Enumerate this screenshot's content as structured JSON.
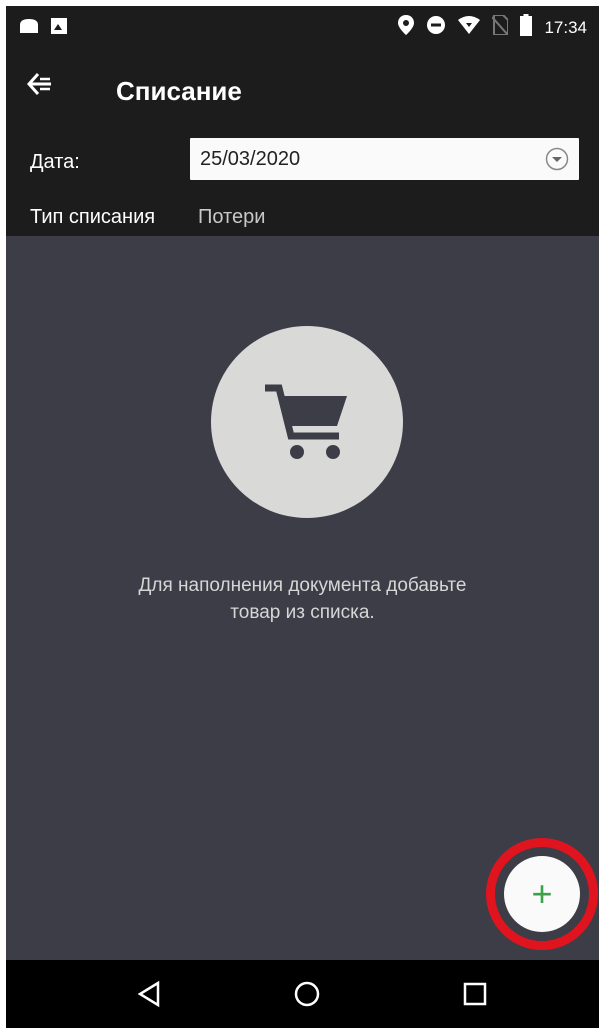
{
  "status_bar": {
    "time": "17:34",
    "icons_left": [
      "notification-icon",
      "photo-icon"
    ],
    "icons_right": [
      "location-icon",
      "do-not-disturb-icon",
      "wifi-icon",
      "no-sim-icon",
      "battery-icon"
    ]
  },
  "app_bar": {
    "title": "Списание",
    "back_icon": "back-icon"
  },
  "form": {
    "date_label": "Дата:",
    "date_value": "25/03/2020",
    "type_label": "Тип списания",
    "type_value": "Потери"
  },
  "empty_state": {
    "icon": "cart-icon",
    "message": "Для наполнения документа добавьте товар из списка."
  },
  "fab": {
    "label": "+",
    "highlight_color": "#e0141e"
  },
  "nav": {
    "buttons": [
      "back-triangle-icon",
      "home-circle-icon",
      "recents-square-icon"
    ]
  },
  "colors": {
    "background": "#3c3d47",
    "bar": "#1c1c1c",
    "accent_plus": "#3aa34a"
  }
}
